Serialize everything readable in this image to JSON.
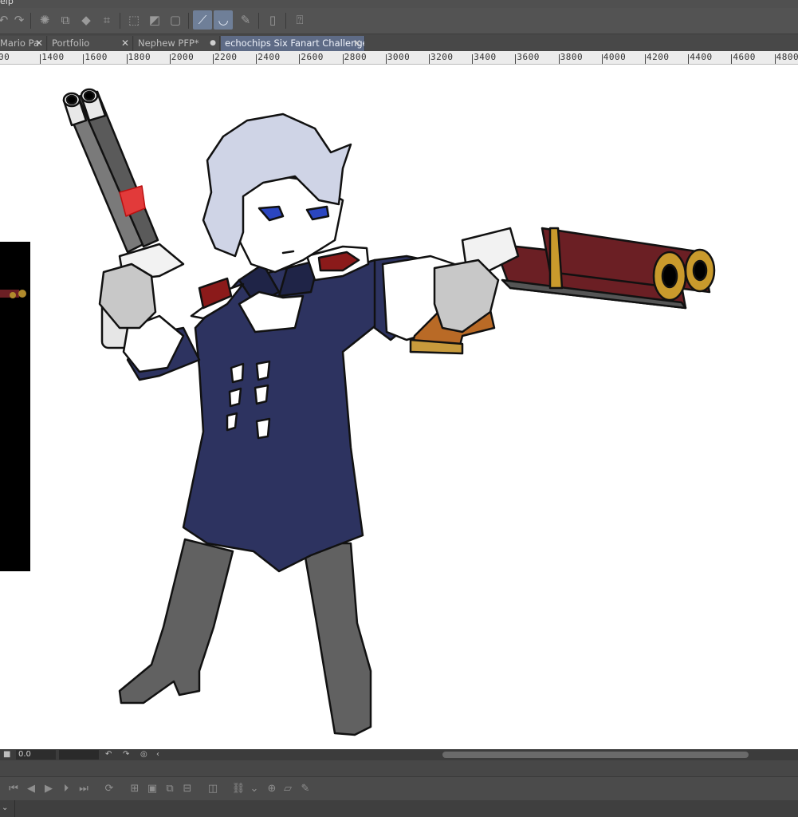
{
  "menu": {
    "partial_label": "elp"
  },
  "tabs": [
    {
      "label": "Mario Pa",
      "close": "✕",
      "active": false
    },
    {
      "label": "Portfolio",
      "close": "✕",
      "active": false
    },
    {
      "label": "Nephew PFP*",
      "close": "●",
      "active": false
    },
    {
      "label": "echochips Six Fanart Challenge",
      "close": "✕",
      "active": true
    }
  ],
  "ruler": {
    "labels": [
      "00",
      "1400",
      "1600",
      "1800",
      "2000",
      "2200",
      "2400",
      "2600",
      "2800",
      "3000",
      "3200",
      "3400",
      "3600",
      "3800",
      "4000",
      "4200",
      "4400",
      "4600",
      "4800"
    ]
  },
  "timeline": {
    "frame_value": "0.0"
  },
  "icons": {
    "toolbar": [
      "undo-icon",
      "redo-icon",
      "lasso-icon",
      "transform-icon",
      "fill-icon",
      "crop-icon",
      "clear-selection-icon",
      "invert-selection-icon",
      "border-icon",
      "ruler-snap-icon",
      "curve-snap-icon",
      "pen-snap-icon",
      "device-icon",
      "help-icon"
    ],
    "bottom": [
      "first-frame-icon",
      "prev-frame-icon",
      "play-icon",
      "next-frame-icon",
      "last-frame-icon",
      "loop-icon",
      "new-cel-icon",
      "cel-icon",
      "cel-copy-icon",
      "cel-delete-icon",
      "onion-skin-icon",
      "link-icon",
      "dropdown-icon",
      "layer-icon",
      "shape-icon",
      "brush-icon"
    ]
  }
}
